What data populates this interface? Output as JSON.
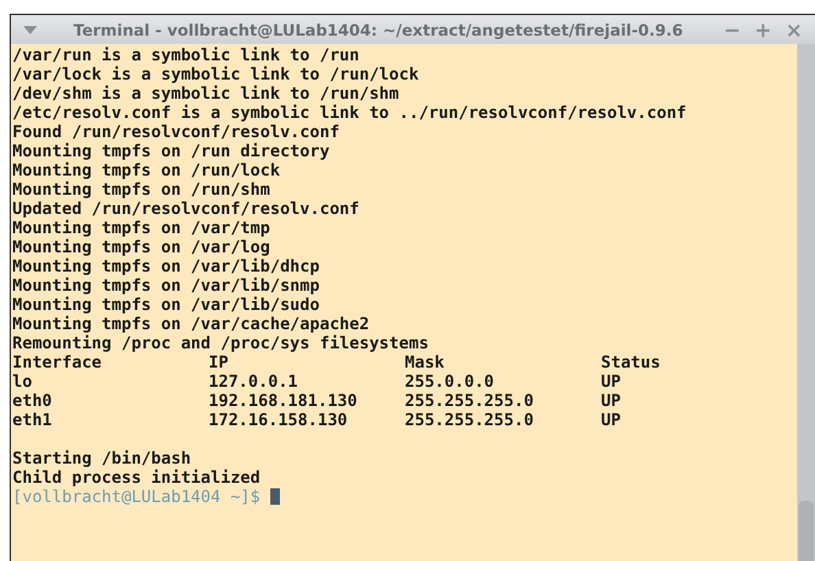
{
  "window": {
    "title": "Terminal - vollbracht@LULab1404: ~/extract/angetestet/firejail-0.9.6",
    "buttons": [
      "−",
      "+",
      "×"
    ]
  },
  "terminal": {
    "output_before": [
      "/var/run is a symbolic link to /run",
      "/var/lock is a symbolic link to /run/lock",
      "/dev/shm is a symbolic link to /run/shm",
      "/etc/resolv.conf is a symbolic link to ../run/resolvconf/resolv.conf",
      "Found /run/resolvconf/resolv.conf",
      "Mounting tmpfs on /run directory",
      "Mounting tmpfs on /run/lock",
      "Mounting tmpfs on /run/shm",
      "Updated /run/resolvconf/resolv.conf",
      "Mounting tmpfs on /var/tmp",
      "Mounting tmpfs on /var/log",
      "Mounting tmpfs on /var/lib/dhcp",
      "Mounting tmpfs on /var/lib/snmp",
      "Mounting tmpfs on /var/lib/sudo",
      "Mounting tmpfs on /var/cache/apache2",
      "Remounting /proc and /proc/sys filesystems"
    ],
    "network_table": {
      "columns": [
        "Interface",
        "IP",
        "Mask",
        "Status"
      ],
      "rows": [
        [
          "lo",
          "127.0.0.1",
          "255.0.0.0",
          "UP"
        ],
        [
          "eth0",
          "192.168.181.130",
          "255.255.255.0",
          "UP"
        ],
        [
          "eth1",
          "172.16.158.130",
          "255.255.255.0",
          "UP"
        ]
      ]
    },
    "output_after": [
      "Starting /bin/bash",
      "Child process initialized"
    ],
    "prompt": "[vollbracht@LULab1404 ~]$"
  }
}
